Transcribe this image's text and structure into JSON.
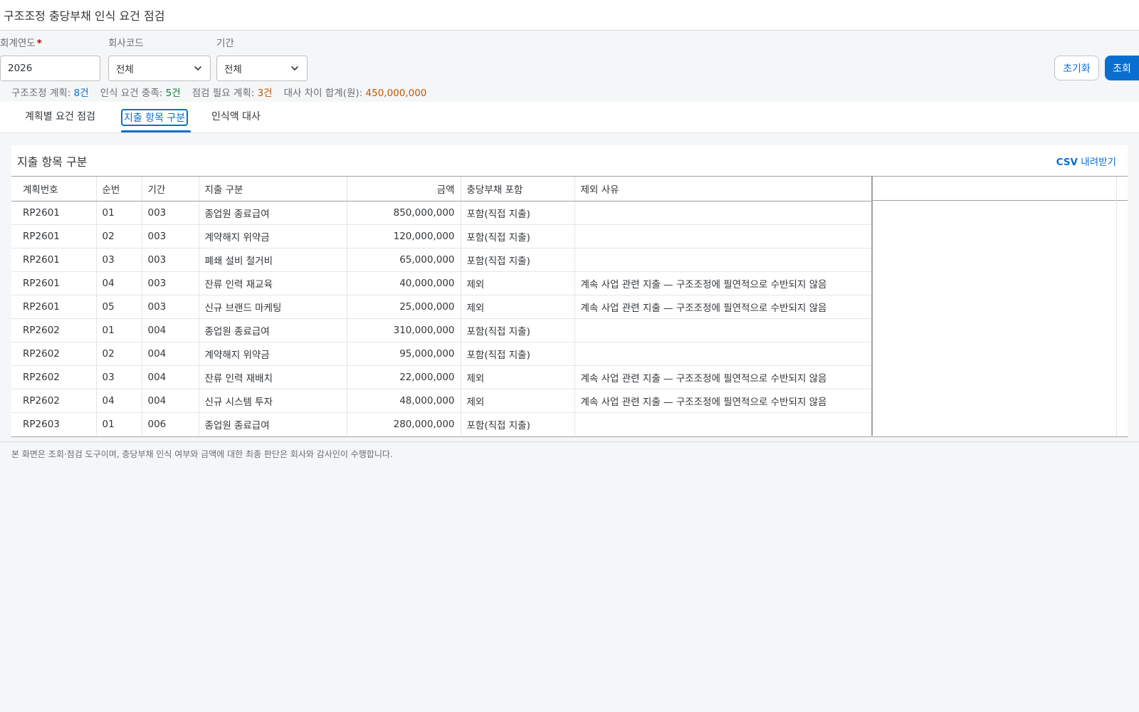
{
  "header": {
    "title": "구조조정 충당부채 인식 요건 점검"
  },
  "filters": {
    "year": {
      "label": "회계연도",
      "required_mark": "*",
      "value": "2026"
    },
    "company": {
      "label": "회사코드",
      "value": "전체"
    },
    "period": {
      "label": "기간",
      "value": "전체"
    }
  },
  "buttons": {
    "reset": "초기화",
    "search": "조회"
  },
  "summary": [
    {
      "label": "구조조정 계획: ",
      "value": "8건",
      "color": "#0a6ed1"
    },
    {
      "label": "인식 요건 충족: ",
      "value": "5건",
      "color": "#107e3e"
    },
    {
      "label": "점검 필요 계획: ",
      "value": "3건",
      "color": "#c35500"
    },
    {
      "label": "대사 차이 합계(원): ",
      "value": "450,000,000",
      "color": "#c35500"
    }
  ],
  "tabs": [
    {
      "label": "계획별 요건 점검",
      "active": false
    },
    {
      "label": "지출 항목 구분",
      "active": true
    },
    {
      "label": "인식액 대사",
      "active": false
    }
  ],
  "panel": {
    "title": "지출 항목 구분",
    "csv_prefix": "CSV",
    "csv_suffix": " 내려받기"
  },
  "table": {
    "columns": [
      "계획번호",
      "순번",
      "기간",
      "지출 구분",
      "금액",
      "충당부채 포함",
      "제외 사유"
    ],
    "rows": [
      [
        "RP2601",
        "01",
        "003",
        "종업원 종료급여",
        "850,000,000",
        "포함(직접 지출)",
        ""
      ],
      [
        "RP2601",
        "02",
        "003",
        "계약해지 위약금",
        "120,000,000",
        "포함(직접 지출)",
        ""
      ],
      [
        "RP2601",
        "03",
        "003",
        "폐쇄 설비 철거비",
        "65,000,000",
        "포함(직접 지출)",
        ""
      ],
      [
        "RP2601",
        "04",
        "003",
        "잔류 인력 재교육",
        "40,000,000",
        "제외",
        "계속 사업 관련 지출 — 구조조정에 필연적으로 수반되지 않음"
      ],
      [
        "RP2601",
        "05",
        "003",
        "신규 브랜드 마케팅",
        "25,000,000",
        "제외",
        "계속 사업 관련 지출 — 구조조정에 필연적으로 수반되지 않음"
      ],
      [
        "RP2602",
        "01",
        "004",
        "종업원 종료급여",
        "310,000,000",
        "포함(직접 지출)",
        ""
      ],
      [
        "RP2602",
        "02",
        "004",
        "계약해지 위약금",
        "95,000,000",
        "포함(직접 지출)",
        ""
      ],
      [
        "RP2602",
        "03",
        "004",
        "잔류 인력 재배치",
        "22,000,000",
        "제외",
        "계속 사업 관련 지출 — 구조조정에 필연적으로 수반되지 않음"
      ],
      [
        "RP2602",
        "04",
        "004",
        "신규 시스템 투자",
        "48,000,000",
        "제외",
        "계속 사업 관련 지출 — 구조조정에 필연적으로 수반되지 않음"
      ],
      [
        "RP2603",
        "01",
        "006",
        "종업원 종료급여",
        "280,000,000",
        "포함(직접 지출)",
        ""
      ]
    ]
  },
  "footer": {
    "note": "본 화면은 조회·점검 도구이며, 충당부채 인식 여부와 금액에 대한 최종 판단은 회사와 감사인이 수행합니다."
  },
  "colors": {
    "accent": "#0a6ed1",
    "included": "#107e3e",
    "warning": "#c35500"
  }
}
